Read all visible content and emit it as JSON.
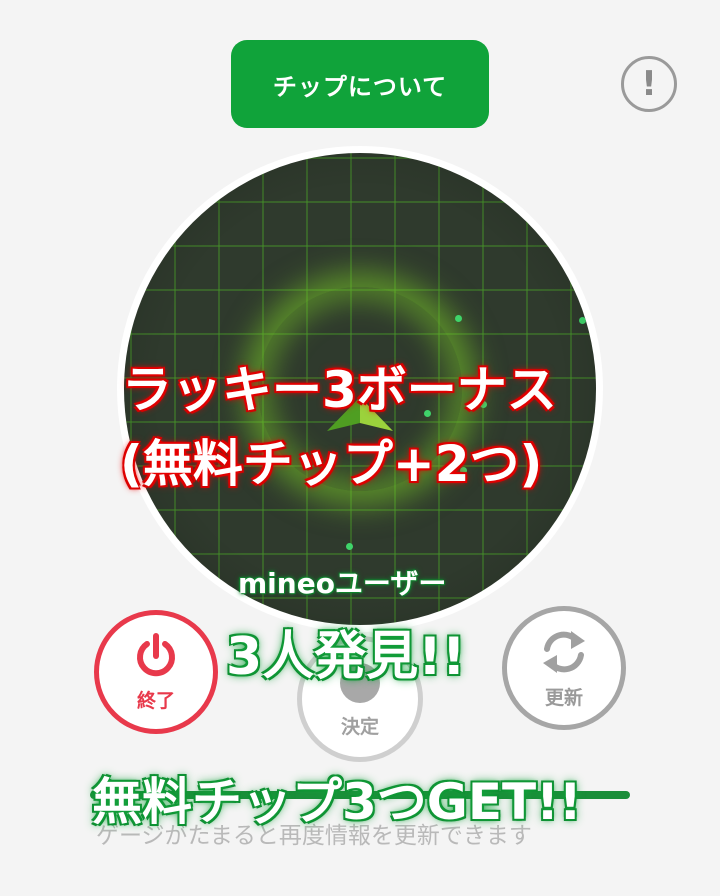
{
  "header": {
    "about_chips_label": "チップについて",
    "info_icon_glyph": "!"
  },
  "radar": {
    "icon": "radar-grid",
    "accent": "#78c828"
  },
  "overlays": {
    "bonus_line1": "ラッキー3ボーナス",
    "bonus_line2": "(無料チップ+2つ)",
    "users_label": "mineoユーザー",
    "found_text": "3人発見!!",
    "get_text": "無料チップ3つGET!!"
  },
  "controls": {
    "end_label": "終了",
    "decide_label": "決定",
    "refresh_label": "更新"
  },
  "footer": {
    "hint": "ゲージがたまると再度情報を更新できます"
  },
  "colors": {
    "primary_green": "#10a33a",
    "end_red": "#e8394b",
    "gray": "#a6a6a6"
  }
}
